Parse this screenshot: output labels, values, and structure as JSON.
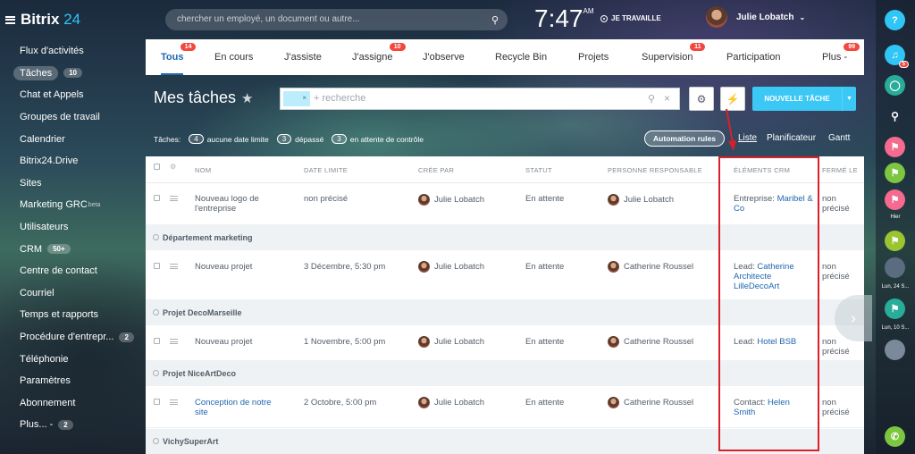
{
  "app": {
    "brand": "Bitrix",
    "brand_num": "24"
  },
  "sidebar": {
    "items": [
      {
        "label": "Flux d'activités"
      },
      {
        "label": "Tâches",
        "badge": "10",
        "active": true
      },
      {
        "label": "Chat et Appels"
      },
      {
        "label": "Groupes de travail"
      },
      {
        "label": "Calendrier"
      },
      {
        "label": "Bitrix24.Drive"
      },
      {
        "label": "Sites"
      },
      {
        "label": "Marketing GRC",
        "sup": "beta"
      },
      {
        "label": "Utilisateurs"
      },
      {
        "label": "CRM",
        "badge": "50+"
      },
      {
        "label": "Centre de contact"
      },
      {
        "label": "Courriel"
      },
      {
        "label": "Temps et rapports"
      },
      {
        "label": "Procédure d'entrepr...",
        "badge": "2"
      },
      {
        "label": "Téléphonie"
      },
      {
        "label": "Paramètres"
      },
      {
        "label": "Abonnement"
      },
      {
        "label": "Plus... -",
        "badge": "2"
      }
    ]
  },
  "header": {
    "search_placeholder": "chercher un employé, un document ou autre...",
    "time": "7:47",
    "ampm": "AM",
    "work_status": "JE TRAVAILLE",
    "user_name": "Julie Lobatch"
  },
  "right_panel": {
    "help_label": "?",
    "notif_badge": "5",
    "labels": [
      "Hier",
      "Lun, 24 S...",
      "Lun, 10 S..."
    ]
  },
  "tabs": [
    {
      "label": "Tous",
      "counter": "14",
      "active": true
    },
    {
      "label": "En cours"
    },
    {
      "label": "J'assiste"
    },
    {
      "label": "J'assigne",
      "counter": "10"
    },
    {
      "label": "J'observe"
    },
    {
      "label": "Recycle Bin"
    },
    {
      "label": "Projets"
    },
    {
      "label": "Supervision",
      "counter": "11"
    },
    {
      "label": "Participation"
    },
    {
      "label": "Plus -",
      "counter": "99"
    }
  ],
  "page": {
    "title": "Mes tâches",
    "filter_placeholder": "+ recherche",
    "add_button": "NOUVELLE TÂCHE"
  },
  "counters": {
    "prefix": "Tâches:",
    "items": [
      {
        "count": "4",
        "label": "aucune date limite"
      },
      {
        "count": "3",
        "label": "dépassé"
      },
      {
        "count": "3",
        "label": "en attente de contrôle"
      }
    ]
  },
  "automation_button": "Automation rules",
  "views": {
    "list": "Liste",
    "planner": "Planificateur",
    "gantt": "Gantt"
  },
  "grid": {
    "columns": [
      "NOM",
      "DATE LIMITE",
      "CRÉE PAR",
      "STATUT",
      "PERSONNE RESPONSABLE",
      "ÉLÉMENTS CRM",
      "FERMÉ LE"
    ],
    "rows": [
      {
        "type": "task",
        "name": "Nouveau logo de l'entreprise",
        "deadline": "non précisé",
        "creator": "Julie Lobatch",
        "status": "En attente",
        "responsible": "Julie Lobatch",
        "crm_type": "Entreprise:",
        "crm_value": "Maribel & Co",
        "closed": "non précisé"
      },
      {
        "type": "group",
        "name": "Département marketing"
      },
      {
        "type": "task",
        "name": "Nouveau projet",
        "deadline": "3 Décembre, 5:30 pm",
        "creator": "Julie Lobatch",
        "status": "En attente",
        "responsible": "Catherine Roussel",
        "crm_type": "Lead:",
        "crm_value": "Catherine Architecte LilleDecoArt",
        "closed": "non précisé"
      },
      {
        "type": "group",
        "name": "Projet DecoMarseille"
      },
      {
        "type": "task",
        "name": "Nouveau projet",
        "deadline": "1 Novembre, 5:00 pm",
        "creator": "Julie Lobatch",
        "status": "En attente",
        "responsible": "Catherine Roussel",
        "crm_type": "Lead:",
        "crm_value": "Hotel BSB",
        "closed": "non précisé"
      },
      {
        "type": "group",
        "name": "Projet NiceArtDeco"
      },
      {
        "type": "task",
        "name": "Conception de notre site",
        "deadline": "2 Octobre, 5:00 pm",
        "creator": "Julie Lobatch",
        "status": "En attente",
        "responsible": "Catherine Roussel",
        "crm_type": "Contact:",
        "crm_value": "Helen Smith",
        "closed": "non précisé"
      },
      {
        "type": "group",
        "name": "VichySuperArt"
      }
    ]
  },
  "colors": {
    "accent": "#2067b0",
    "add_button": "#3bc8f5",
    "counter_red": "#f2483e",
    "highlight": "#d9202b"
  }
}
